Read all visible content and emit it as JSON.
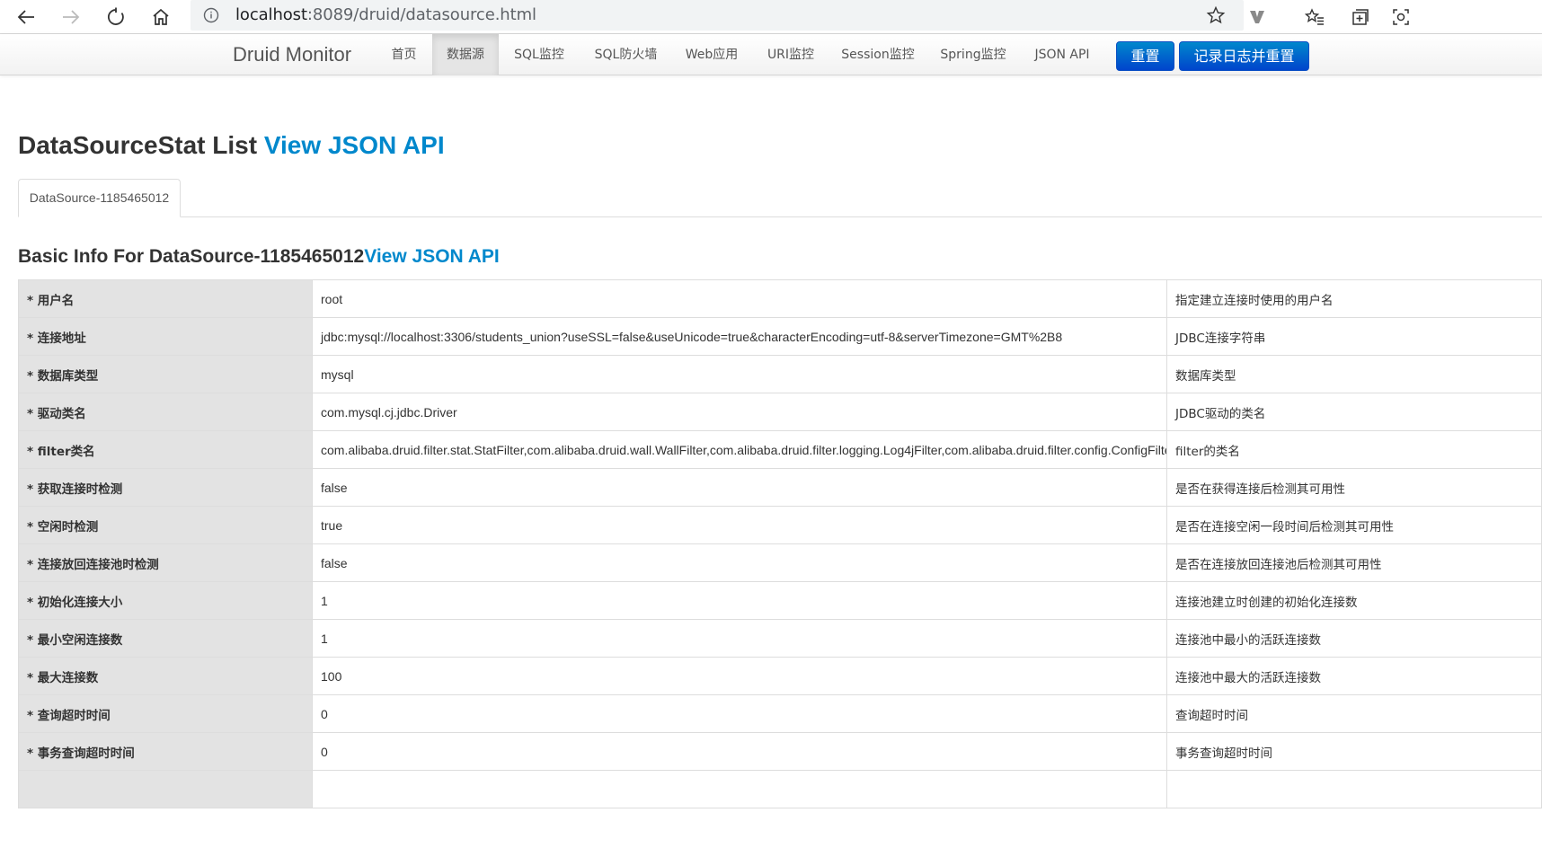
{
  "browser": {
    "url_host": "localhost",
    "url_path": ":8089/druid/datasource.html"
  },
  "nav": {
    "brand": "Druid Monitor",
    "items": [
      {
        "label": "首页"
      },
      {
        "label": "数据源",
        "active": true
      },
      {
        "label": "SQL监控"
      },
      {
        "label": "SQL防火墙"
      },
      {
        "label": "Web应用"
      },
      {
        "label": "URI监控"
      },
      {
        "label": "Session监控"
      },
      {
        "label": "Spring监控"
      },
      {
        "label": "JSON API"
      }
    ],
    "reset_label": "重置",
    "log_reset_label": "记录日志并重置"
  },
  "page": {
    "title": "DataSourceStat List ",
    "title_link": "View JSON API",
    "tab_label": "DataSource-1185465012",
    "section_title": "Basic Info For DataSource-1185465012",
    "section_link": "View JSON API"
  },
  "table": {
    "rows": [
      {
        "label": "* 用户名",
        "value": "root",
        "desc": "指定建立连接时使用的用户名"
      },
      {
        "label": "* 连接地址",
        "value": "jdbc:mysql://localhost:3306/students_union?useSSL=false&useUnicode=true&characterEncoding=utf-8&serverTimezone=GMT%2B8",
        "desc": "JDBC连接字符串"
      },
      {
        "label": "* 数据库类型",
        "value": "mysql",
        "desc": "数据库类型"
      },
      {
        "label": "* 驱动类名",
        "value": "com.mysql.cj.jdbc.Driver",
        "desc": "JDBC驱动的类名"
      },
      {
        "label": "* filter类名",
        "value": "com.alibaba.druid.filter.stat.StatFilter,com.alibaba.druid.wall.WallFilter,com.alibaba.druid.filter.logging.Log4jFilter,com.alibaba.druid.filter.config.ConfigFilter",
        "desc": "filter的类名"
      },
      {
        "label": "* 获取连接时检测",
        "value": "false",
        "desc": "是否在获得连接后检测其可用性"
      },
      {
        "label": "* 空闲时检测",
        "value": "true",
        "desc": "是否在连接空闲一段时间后检测其可用性"
      },
      {
        "label": "* 连接放回连接池时检测",
        "value": "false",
        "desc": "是否在连接放回连接池后检测其可用性"
      },
      {
        "label": "* 初始化连接大小",
        "value": "1",
        "desc": "连接池建立时创建的初始化连接数"
      },
      {
        "label": "* 最小空闲连接数",
        "value": "1",
        "desc": "连接池中最小的活跃连接数"
      },
      {
        "label": "* 最大连接数",
        "value": "100",
        "desc": "连接池中最大的活跃连接数"
      },
      {
        "label": "* 查询超时时间",
        "value": "0",
        "desc": "查询超时时间"
      },
      {
        "label": "* 事务查询超时时间",
        "value": "0",
        "desc": "事务查询超时时间"
      },
      {
        "label": "",
        "value": "",
        "desc": ""
      }
    ]
  },
  "colors": {
    "link": "#0088cc",
    "primary_button": "#0055cc",
    "label_cell_bg": "#e3e3e3"
  }
}
